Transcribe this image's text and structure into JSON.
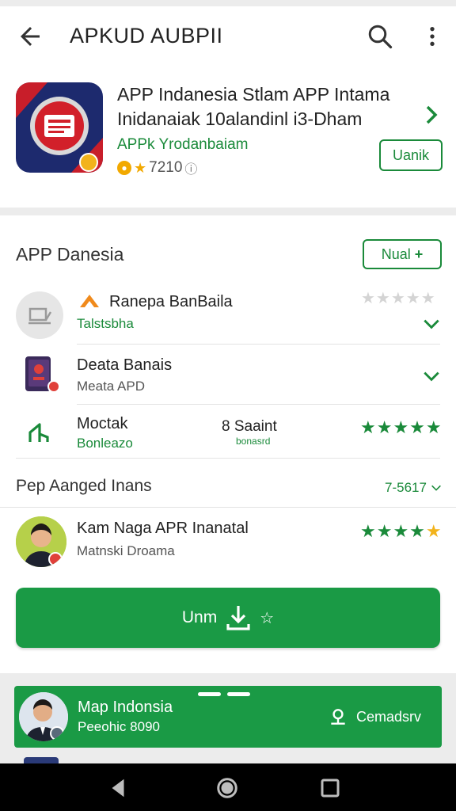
{
  "appbar": {
    "title": "APKUD AUBPII",
    "back_icon": "arrow-back-icon",
    "search_icon": "search-icon",
    "more_icon": "more-vert-icon"
  },
  "app": {
    "title": "APP Indanesia Stlam APP Intama Inidanaiak 10alandinl i3-Dham",
    "developer": "APPk Yrodanbaiam",
    "rating": "7210",
    "unlock_label": "Uanik",
    "icon": "news-app-icon"
  },
  "section": {
    "title": "APP Danesia",
    "new_label": "Nual",
    "items": [
      {
        "name": "Ranepa BanBaila",
        "sub": "Talstsbha",
        "stars": 0,
        "icon": "sweep-icon"
      },
      {
        "name": "Deata Banais",
        "sub": "Meata APD",
        "icon": "book-app-icon"
      },
      {
        "name": "Moctak",
        "sub": "Bonleazo",
        "mid": "8 Saaint",
        "mid_sub": "bonasrd",
        "stars": 5,
        "icon": "sprout-icon"
      }
    ],
    "group_title": "Pep Aanged Inans",
    "group_value": "7-5617",
    "person": {
      "name": "Kam Naga APR Inanatal",
      "sub": "Matnski Droama",
      "stars": 4,
      "icon": "user-avatar-icon"
    }
  },
  "cta": {
    "label": "Unm",
    "icon": "download-icon"
  },
  "bottom_bar": {
    "title": "Map Indonsia",
    "sub": "Peeohic 8090",
    "action": "Cemadsrv",
    "action_icon": "award-icon",
    "avatar_icon": "user-avatar-icon"
  },
  "colors": {
    "accent": "#1a9a45",
    "text_green": "#1a8a3a",
    "star_gold": "#f2b31c"
  }
}
